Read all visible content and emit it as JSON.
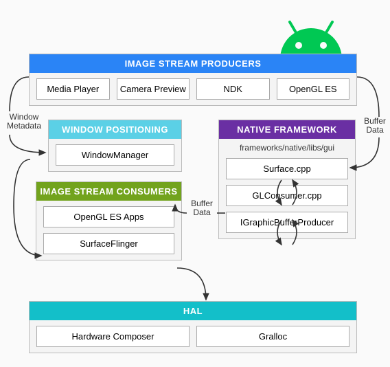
{
  "producers": {
    "title": "IMAGE STREAM PRODUCERS",
    "items": [
      "Media Player",
      "Camera Preview",
      "NDK",
      "OpenGL ES"
    ]
  },
  "windowPositioning": {
    "title": "WINDOW POSITIONING",
    "items": [
      "WindowManager"
    ]
  },
  "consumers": {
    "title": "IMAGE STREAM CONSUMERS",
    "items": [
      "OpenGL ES Apps",
      "SurfaceFlinger"
    ]
  },
  "nativeFramework": {
    "title": "NATIVE FRAMEWORK",
    "subtitle": "frameworks/native/libs/gui",
    "items": [
      "Surface.cpp",
      "GLConsumer.cpp",
      "IGraphicBufferProducer"
    ]
  },
  "hal": {
    "title": "HAL",
    "items": [
      "Hardware Composer",
      "Gralloc"
    ]
  },
  "labels": {
    "windowMetadata": "Window\nMetadata",
    "bufferData1": "Buffer\nData",
    "bufferData2": "Buffer\nData"
  }
}
